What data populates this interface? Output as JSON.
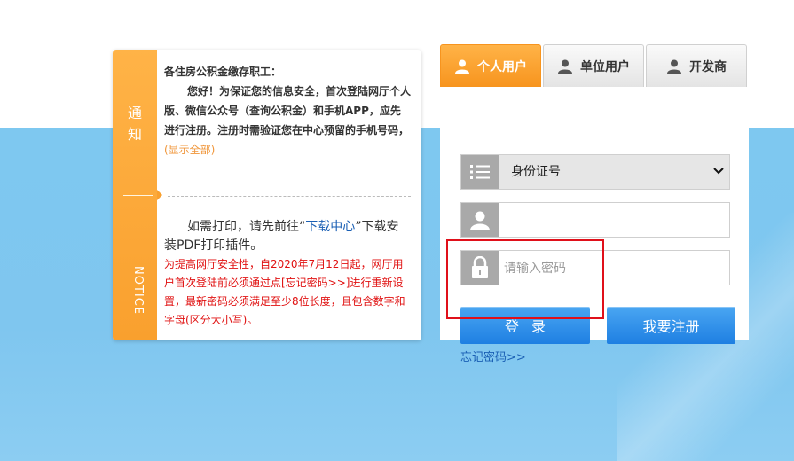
{
  "notice": {
    "label_cn": "通知",
    "label_en": "NOTICE",
    "greeting": "各住房公积金缴存职工：",
    "body": "您好！为保证您的信息安全，首次登陆网厅个人版、微信公众号（查询公积金）和手机APP，应先进行注册。注册时需验证您在中心预留的手机号码，",
    "show_all": "(显示全部)",
    "print_prefix": "如需打印，请先前往“",
    "download_center": "下载中心",
    "print_suffix": "”下载安装PDF打印插件。",
    "warning": "为提高网厅安全性，自2020年7月12日起，网厅用户首次登陆前必须通过点[忘记密码>>]进行重新设置，最新密码必须满足至少8位长度，且包含数字和字母(区分大小写)。"
  },
  "login": {
    "tabs": [
      {
        "label": "个人用户",
        "icon": "user-icon",
        "active": true
      },
      {
        "label": "单位用户",
        "icon": "user-icon",
        "active": false
      },
      {
        "label": "开发商",
        "icon": "user-icon",
        "active": false
      }
    ],
    "id_type": {
      "selected": "身份证号",
      "icon": "list-icon"
    },
    "username": {
      "value": "",
      "placeholder": "",
      "icon": "user-icon"
    },
    "password": {
      "value": "",
      "placeholder": "请输入密码",
      "icon": "lock-icon"
    },
    "login_button": "登录",
    "register_button": "我要注册",
    "forgot_link": "忘记密码>>"
  },
  "colors": {
    "accent_orange": "#f7941e",
    "button_blue": "#1e7fe2",
    "link_blue": "#1a5fb4",
    "warning_red": "#e01010",
    "highlight_red": "#e0101a"
  }
}
